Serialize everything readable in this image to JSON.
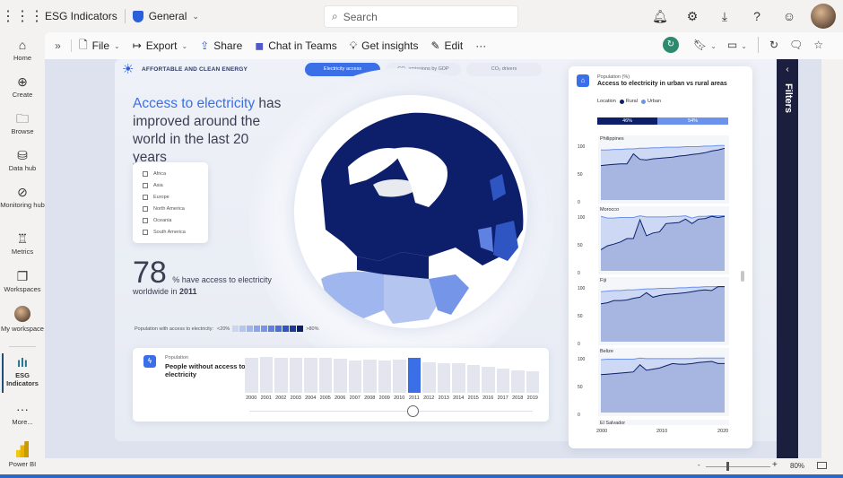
{
  "app": {
    "title": "ESG Indicators",
    "workspace": "General"
  },
  "search": {
    "placeholder": "Search"
  },
  "top_icons": [
    "bell-icon",
    "gear-icon",
    "download-icon",
    "help-icon",
    "feedback-icon",
    "avatar"
  ],
  "nav": [
    {
      "label": "Home",
      "icon": "home-icon"
    },
    {
      "label": "Create",
      "icon": "plus-circle-icon"
    },
    {
      "label": "Browse",
      "icon": "folder-icon"
    },
    {
      "label": "Data hub",
      "icon": "data-hub-icon"
    },
    {
      "label": "Monitoring hub",
      "icon": "monitoring-icon"
    },
    {
      "label": "Metrics",
      "icon": "trophy-icon"
    },
    {
      "label": "Workspaces",
      "icon": "workspaces-icon"
    },
    {
      "label": "My workspace",
      "icon": "avatar"
    },
    {
      "label": "ESG Indicators",
      "icon": "report-icon",
      "active": true
    },
    {
      "label": "More...",
      "icon": "more-icon"
    },
    {
      "label": "Power BI",
      "icon": "power-bi-logo"
    }
  ],
  "toolbar": {
    "file": "File",
    "export": "Export",
    "share": "Share",
    "chat": "Chat in Teams",
    "insights": "Get insights",
    "edit": "Edit",
    "more": "···"
  },
  "filters_label": "Filters",
  "report": {
    "section_title": "AFFORTABLE AND CLEAN ENERGY",
    "tabs": [
      {
        "label": "Electricity access",
        "active": true
      },
      {
        "label": "CO₂ emissions by GDP",
        "active": false
      },
      {
        "label": "CO₂ drivers",
        "active": false
      }
    ],
    "headline_highlight": "Access to electricity",
    "headline_rest": " has improved around the world in the last 20 years",
    "regions": [
      "Africa",
      "Asia",
      "Europe",
      "North America",
      "Oceania",
      "South America"
    ],
    "stat_value": "78",
    "stat_text": "% have access to electricity",
    "stat_text2_prefix": "worldwide in ",
    "stat_year": "2011",
    "legend_label": "Population with access to electricity:",
    "legend_low": "<20%",
    "legend_high": ">80%",
    "legend_colors": [
      "#c9d6f2",
      "#b4c6f0",
      "#9fb6ee",
      "#8aa5eb",
      "#7595e9",
      "#5f82e2",
      "#4a6fd8",
      "#2f55c2",
      "#1a3a9c",
      "#0d1f6b"
    ],
    "timeline": {
      "subtitle": "Population",
      "title": "People without access to electricity",
      "years": [
        "2000",
        "2001",
        "2002",
        "2003",
        "2004",
        "2005",
        "2006",
        "2007",
        "2008",
        "2009",
        "2010",
        "2011",
        "2012",
        "2013",
        "2014",
        "2015",
        "2016",
        "2017",
        "2018",
        "2019"
      ],
      "values": [
        0.92,
        0.95,
        0.94,
        0.93,
        0.92,
        0.93,
        0.91,
        0.85,
        0.87,
        0.86,
        0.87,
        0.93,
        0.81,
        0.79,
        0.78,
        0.73,
        0.68,
        0.65,
        0.6,
        0.56
      ],
      "selected": "2011"
    },
    "urban_rural": {
      "subtitle": "Population (%)",
      "title": "Access to electricity in urban vs rural areas",
      "legend_title": "Location",
      "rural_label": "Rural",
      "urban_label": "Urban",
      "rural_color": "#0d1f6b",
      "urban_color": "#6b93ec",
      "rural_pct": "46%",
      "urban_pct": "54%",
      "rural_share": 46,
      "y_ticks": [
        "100",
        "50",
        "0"
      ],
      "x_ticks": [
        "2000",
        "2010",
        "2020"
      ],
      "countries": [
        {
          "name": "Philippines",
          "urban": [
            90,
            90,
            91,
            91,
            92,
            92,
            93,
            93,
            94,
            94,
            95,
            95,
            95,
            96,
            96,
            96,
            97,
            97,
            98,
            98
          ],
          "rural": [
            62,
            63,
            64,
            65,
            65,
            83,
            73,
            72,
            74,
            75,
            76,
            77,
            79,
            80,
            82,
            83,
            85,
            88,
            90,
            93
          ]
        },
        {
          "name": "Morocco",
          "urban": [
            98,
            95,
            95,
            96,
            96,
            96,
            99,
            97,
            97,
            97,
            97,
            98,
            98,
            99,
            95,
            98,
            98,
            99,
            99,
            99
          ],
          "rural": [
            38,
            45,
            48,
            52,
            58,
            58,
            92,
            63,
            68,
            70,
            85,
            86,
            87,
            93,
            85,
            93,
            94,
            98,
            96,
            98
          ]
        },
        {
          "name": "Fiji",
          "urban": [
            90,
            91,
            92,
            92,
            93,
            93,
            94,
            95,
            95,
            96,
            96,
            96,
            97,
            97,
            98,
            98,
            99,
            99,
            99,
            99
          ],
          "rural": [
            68,
            70,
            74,
            74,
            75,
            78,
            80,
            88,
            80,
            83,
            85,
            86,
            87,
            88,
            90,
            92,
            93,
            92,
            99,
            99
          ]
        },
        {
          "name": "Belize",
          "urban": [
            95,
            96,
            96,
            96,
            96,
            96,
            98,
            97,
            97,
            97,
            97,
            97,
            97,
            97,
            97,
            98,
            98,
            98,
            98,
            98
          ],
          "rural": [
            68,
            69,
            70,
            71,
            72,
            73,
            86,
            76,
            78,
            80,
            84,
            88,
            87,
            87,
            88,
            90,
            91,
            92,
            88,
            88
          ]
        }
      ],
      "next_country_partial": "El Salvador"
    }
  },
  "zoom": {
    "minus": "-",
    "plus": "+",
    "value": "80%"
  }
}
